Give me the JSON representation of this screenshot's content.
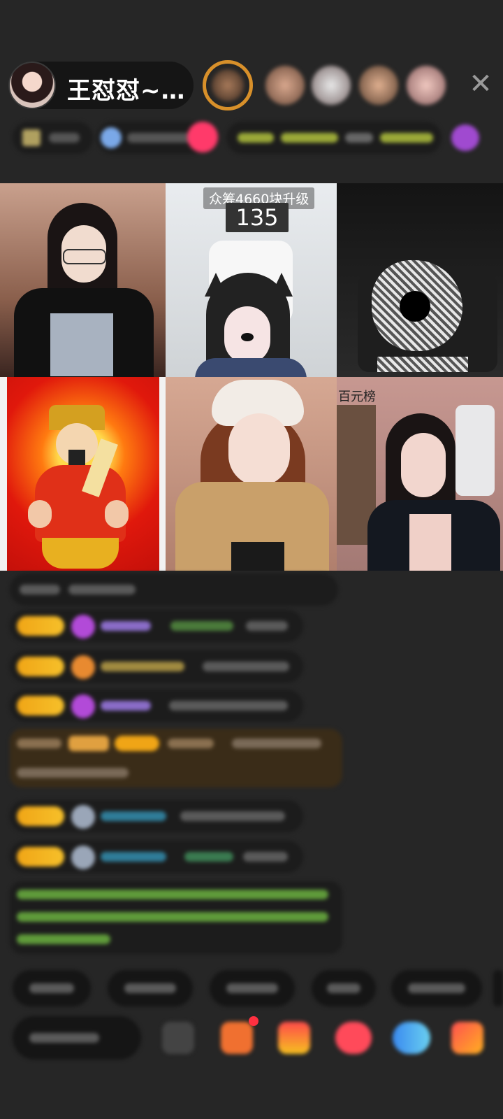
{
  "header": {
    "host_name": "王怼怼~…",
    "close_icon": "close-icon",
    "colors": {
      "pill": "#151515",
      "accent_gold": "#d8902a"
    }
  },
  "grid": {
    "crowdfund_label": "众筹4660块升级",
    "crowdfund_count": "135",
    "rank_label": "百元榜"
  },
  "colors": {
    "background": "#262626",
    "tag_gold": "#f0a516",
    "chat_green": "#6fbf3a",
    "chat_purple": "#9b6fe0",
    "chat_cyan": "#2fa6c8"
  },
  "icons": {
    "gift": "gift-icon",
    "more": "more-icon",
    "emoji": "emoji-icon"
  }
}
